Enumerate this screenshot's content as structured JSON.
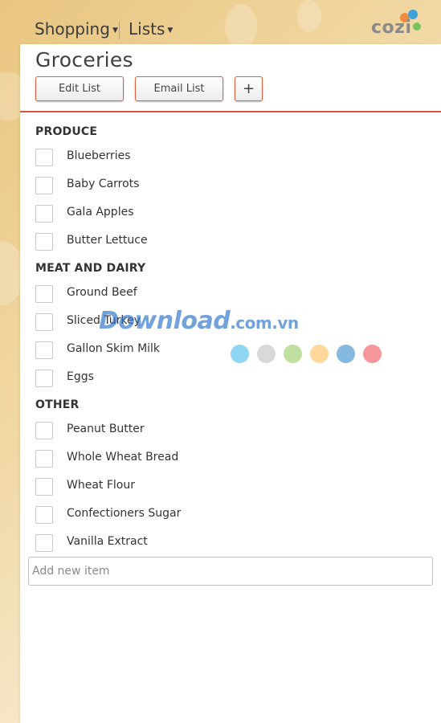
{
  "nav": {
    "shopping_label": "Shopping",
    "lists_label": "Lists"
  },
  "logo": {
    "text": "cozi"
  },
  "list": {
    "title": "Groceries",
    "edit_button": "Edit List",
    "email_button": "Email List",
    "add_button": "+"
  },
  "sections": [
    {
      "name": "PRODUCE",
      "items": [
        "Blueberries",
        "Baby Carrots",
        "Gala Apples",
        "Butter Lettuce"
      ]
    },
    {
      "name": "MEAT AND DAIRY",
      "items": [
        "Ground Beef",
        "Sliced Turkey",
        "Gallon Skim Milk",
        "Eggs"
      ]
    },
    {
      "name": "OTHER",
      "items": [
        "Peanut Butter",
        "Whole Wheat Bread",
        "Wheat Flour",
        "Confectioners Sugar",
        "Vanilla Extract"
      ]
    }
  ],
  "add_item": {
    "placeholder": "Add new item"
  },
  "watermark": {
    "text_main": "Download",
    "text_suffix": ".com.vn",
    "dot_colors": [
      "#8fd6f5",
      "#d9d9d9",
      "#bfe0a0",
      "#ffd79a",
      "#86b9df",
      "#f4969a"
    ]
  },
  "colors": {
    "accent": "#d8553a",
    "background": "#e9c57f"
  }
}
